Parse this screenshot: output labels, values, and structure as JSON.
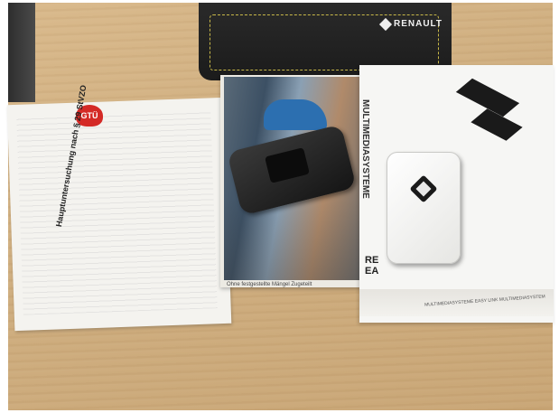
{
  "scene": {
    "folder": {
      "brand": "RENAULT"
    },
    "certificate": {
      "logo_text": "GTÜ",
      "heading": "Hauptuntersuchung nach § 29 StVZO"
    },
    "manual": {
      "footer_text": "Ohne festgestellte Mängel   Zugeteilt"
    },
    "multimedia_book": {
      "title": "MULTIMEDIASYSTEME",
      "cover_letters": "RE\nEA",
      "spine_text": "MULTIMEDIASYSTEME   EASY LINK MULTIMEDIASYSTEM"
    }
  }
}
